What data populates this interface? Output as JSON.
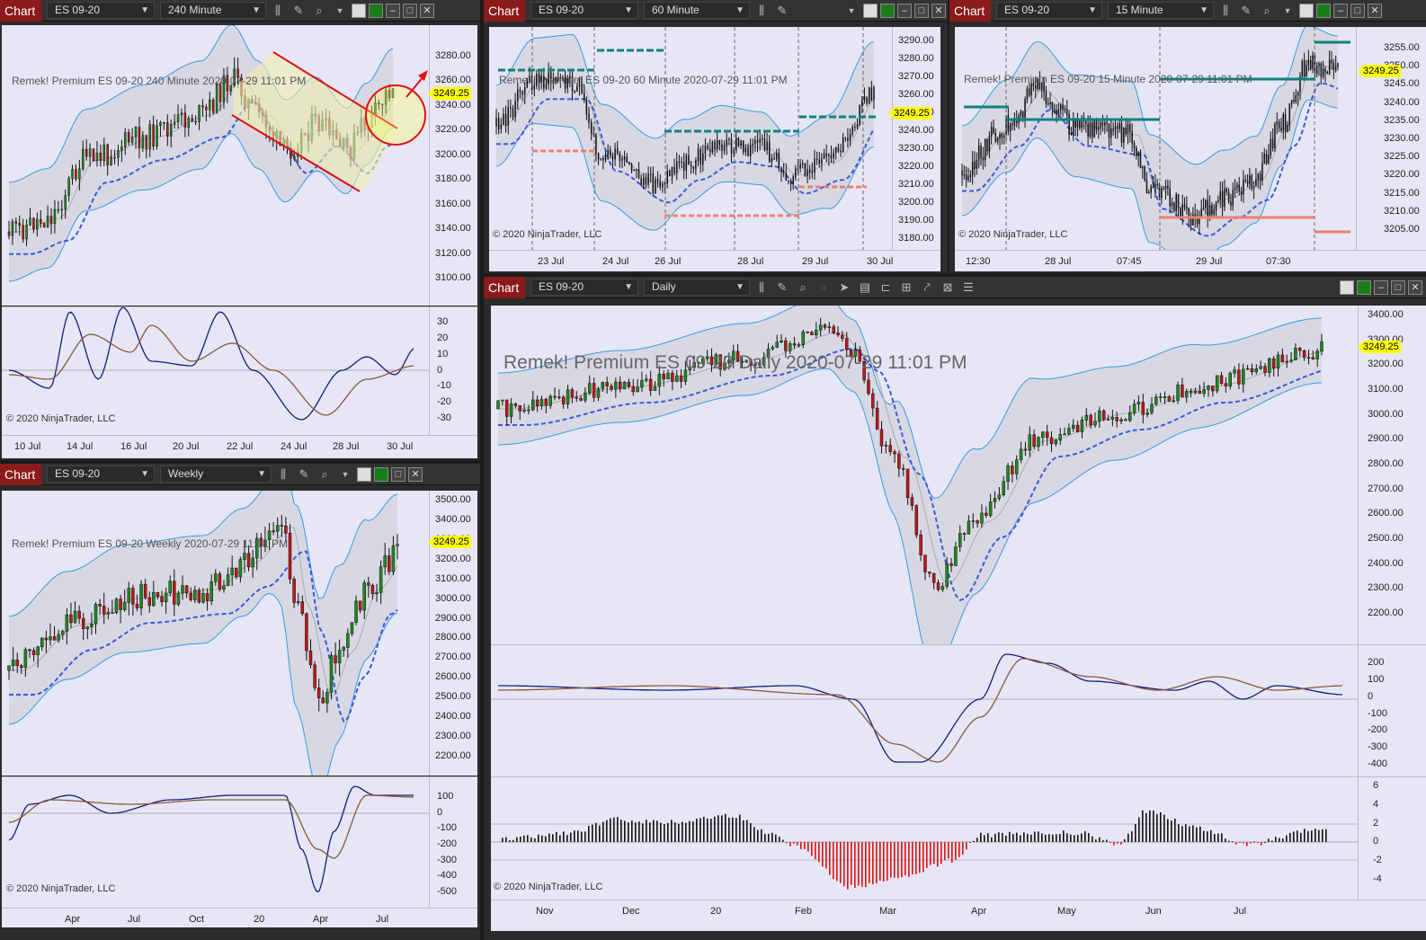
{
  "common": {
    "chart_label": "Chart",
    "instrument": "ES 09-20",
    "copyright": "© 2020 NinjaTrader, LLC",
    "last_price": "3249.25",
    "minimize_icon": "minimize-icon",
    "maximize_icon": "maximize-icon",
    "close_icon": "close-icon"
  },
  "colors": {
    "bg": "#e6e6f6",
    "up": "#1e8c1e",
    "down": "#c01818",
    "band": "#4aa0e0",
    "mid": "#4060d0",
    "price_tag": "#ffff00"
  },
  "windows": [
    {
      "id": "w240",
      "interval": "240 Minute",
      "title_text": "Remek!  Premium  ES 09-20  240 Minute  2020-07-29 11:01 PM",
      "price_ticks": [
        "3280.00",
        "3260.00",
        "3240.00",
        "3220.00",
        "3200.00",
        "3180.00",
        "3160.00",
        "3140.00",
        "3120.00",
        "3100.00"
      ],
      "osc_ticks": [
        "30",
        "20",
        "10",
        "0",
        "-10",
        "-20",
        "-30"
      ],
      "x_ticks": [
        "10 Jul",
        "14 Jul",
        "16 Jul",
        "20 Jul",
        "22 Jul",
        "24 Jul",
        "28 Jul",
        "30 Jul"
      ]
    },
    {
      "id": "w60",
      "interval": "60 Minute",
      "title_text": "Remek!  Premium  ES 09-20  60 Minute  2020-07-29 11:01 PM",
      "price_ticks": [
        "3290.00",
        "3280.00",
        "3270.00",
        "3260.00",
        "3250.00",
        "3240.00",
        "3230.00",
        "3220.00",
        "3210.00",
        "3200.00",
        "3190.00",
        "3180.00"
      ],
      "x_ticks": [
        "23 Jul",
        "24 Jul",
        "26 Jul",
        "28 Jul",
        "29 Jul",
        "30 Jul"
      ]
    },
    {
      "id": "w15",
      "interval": "15 Minute",
      "title_text": "Remek!  Premium  ES 09-20  15 Minute  2020-07-29 11:01 PM",
      "price_ticks": [
        "3255.00",
        "3250.00",
        "3245.00",
        "3240.00",
        "3235.00",
        "3230.00",
        "3225.00",
        "3220.00",
        "3215.00",
        "3210.00",
        "3205.00"
      ],
      "x_ticks": [
        "12:30",
        "28 Jul",
        "07:45",
        "29 Jul",
        "07:30"
      ]
    },
    {
      "id": "wweek",
      "interval": "Weekly",
      "title_text": "Remek!  Premium  ES 09-20  Weekly  2020-07-29 11:01 PM",
      "price_ticks": [
        "3500.00",
        "3400.00",
        "3300.00",
        "3200.00",
        "3100.00",
        "3000.00",
        "2900.00",
        "2800.00",
        "2700.00",
        "2600.00",
        "2500.00",
        "2400.00",
        "2300.00",
        "2200.00"
      ],
      "osc_ticks": [
        "100",
        "0",
        "-100",
        "-200",
        "-300",
        "-400",
        "-500"
      ],
      "x_ticks": [
        "Apr",
        "Jul",
        "Oct",
        "20",
        "Apr",
        "Jul"
      ]
    },
    {
      "id": "wdaily",
      "interval": "Daily",
      "title_text": "Remek!  Premium  ES 09-20  Daily  2020-07-29 11:01 PM",
      "price_ticks": [
        "3400.00",
        "3300.00",
        "3200.00",
        "3100.00",
        "3000.00",
        "2900.00",
        "2800.00",
        "2700.00",
        "2600.00",
        "2500.00",
        "2400.00",
        "2300.00",
        "2200.00"
      ],
      "osc_ticks": [
        "200",
        "100",
        "0",
        "-100",
        "-200",
        "-300",
        "-400"
      ],
      "hist_ticks": [
        "6",
        "4",
        "2",
        "0",
        "-2",
        "-4"
      ],
      "x_ticks": [
        "Nov",
        "Dec",
        "20",
        "Feb",
        "Mar",
        "Apr",
        "May",
        "Jun",
        "Jul"
      ]
    }
  ]
}
